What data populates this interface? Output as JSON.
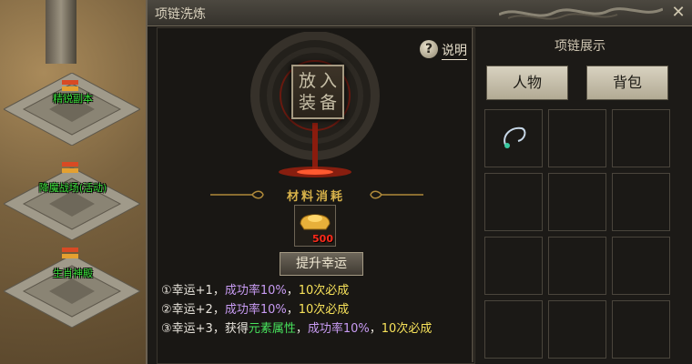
{
  "world": {
    "portals": [
      {
        "label": "精锐副本"
      },
      {
        "label": "降魔战场(活动)"
      },
      {
        "label": "生肖神殿"
      }
    ]
  },
  "window": {
    "title": "项链洗炼",
    "close_icon": "close-icon"
  },
  "refine": {
    "slot_label": "放入装备",
    "help_label": "说明",
    "help_icon": "question-icon",
    "material_title": "材料消耗",
    "material": {
      "icon": "gold-ingot-icon",
      "count": "500"
    },
    "boost_button": "提升幸运",
    "rules": [
      {
        "prefix": "①幸运+1，",
        "rate": "成功率10%",
        "sep": "，",
        "guarantee": "10次必成"
      },
      {
        "prefix": "②幸运+2，",
        "rate": "成功率10%",
        "sep": "，",
        "guarantee": "10次必成"
      },
      {
        "prefix": "③幸运+3，获得",
        "element": "元素属性",
        "sep1": "，",
        "rate": "成功率10%",
        "sep2": "，",
        "guarantee": "10次必成"
      }
    ]
  },
  "display": {
    "title": "项链展示",
    "tabs": [
      {
        "label": "人物"
      },
      {
        "label": "背包"
      }
    ],
    "items": [
      {
        "icon": "necklace-icon",
        "slot": 0
      }
    ]
  },
  "colors": {
    "rate": "#c99cf4",
    "guarantee": "#f7e25a",
    "element": "#47e35c",
    "portal_label": "#39e039"
  }
}
